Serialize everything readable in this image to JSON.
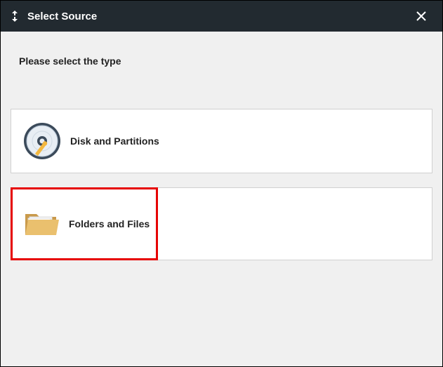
{
  "header": {
    "title": "Select Source"
  },
  "instruction": "Please select the type",
  "options": {
    "disk": {
      "label": "Disk and Partitions"
    },
    "folders": {
      "label": "Folders and Files"
    }
  }
}
